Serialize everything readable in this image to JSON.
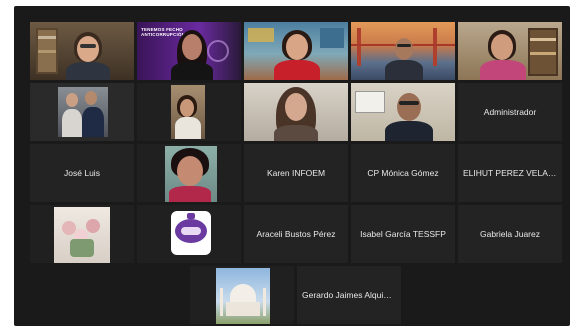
{
  "meeting": {
    "participants": [
      {
        "id": "p1",
        "label": "",
        "video": "woman-bookshelf"
      },
      {
        "id": "p2",
        "label": "",
        "video": "woman-purple-banner"
      },
      {
        "id": "p3",
        "label": "",
        "video": "woman-red-office"
      },
      {
        "id": "p4",
        "label": "",
        "video": "man-golden-gate"
      },
      {
        "id": "p5",
        "label": "",
        "video": "woman-pink-bookshelf"
      },
      {
        "id": "p6",
        "label": "",
        "video": "couple-photo",
        "active_speaker": true
      },
      {
        "id": "p7",
        "label": "",
        "video": "woman-doorway"
      },
      {
        "id": "p8",
        "label": "",
        "video": "woman-long-hair"
      },
      {
        "id": "p9",
        "label": "",
        "video": "man-glasses"
      },
      {
        "id": "p10",
        "label": "Administrador",
        "video": "none"
      },
      {
        "id": "p11",
        "label": "José Luis",
        "video": "none"
      },
      {
        "id": "p12",
        "label": "",
        "video": "woman-selfie"
      },
      {
        "id": "p13",
        "label": "Karen INFOEM",
        "video": "none"
      },
      {
        "id": "p14",
        "label": "CP Mónica Gómez",
        "video": "none"
      },
      {
        "id": "p15",
        "label": "ELIHUT PEREZ VELAZQ...",
        "video": "none"
      },
      {
        "id": "p16",
        "label": "",
        "video": "flowers-photo"
      },
      {
        "id": "p17",
        "label": "",
        "video": "handshake-logo"
      },
      {
        "id": "p18",
        "label": "Araceli Bustos Pérez",
        "video": "none"
      },
      {
        "id": "p19",
        "label": "Isabel García TESSFP",
        "video": "none"
      },
      {
        "id": "p20",
        "label": "Gabriela Juarez",
        "video": "none"
      },
      {
        "id": "p21",
        "label": "",
        "video": "taj-mahal-photo"
      },
      {
        "id": "p22",
        "label": "Gerardo Jaimes Alquisir...",
        "video": "none"
      }
    ],
    "banner": {
      "line1": "TENEMOS FECHO",
      "line2": "ANTICORRUPCIÓN"
    }
  },
  "colors": {
    "background": "#1a1a1a",
    "tile": "#232323",
    "active_speaker_border": "#23d96a",
    "name_text": "#e8e8e8"
  }
}
